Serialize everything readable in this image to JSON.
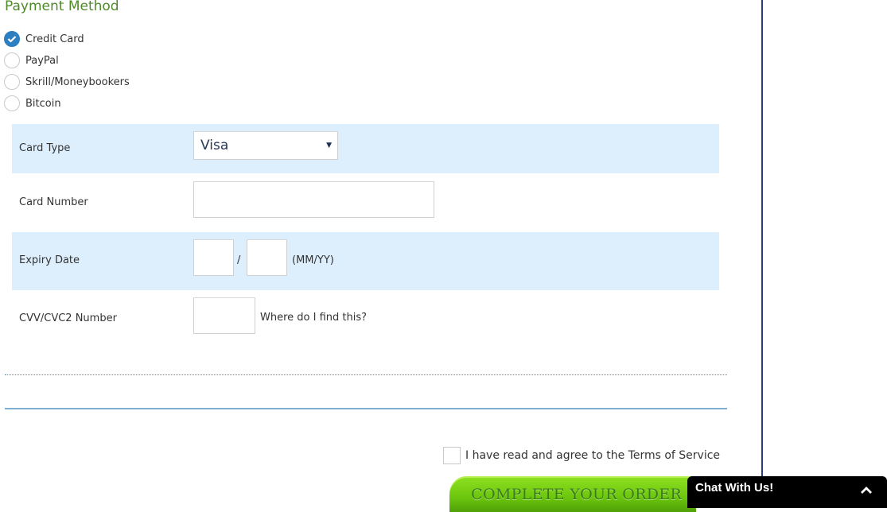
{
  "section_title": "Payment Method",
  "payment_methods": [
    {
      "label": "Credit Card",
      "selected": true
    },
    {
      "label": "PayPal",
      "selected": false
    },
    {
      "label": "Skrill/Moneybookers",
      "selected": false
    },
    {
      "label": "Bitcoin",
      "selected": false
    }
  ],
  "fields": {
    "card_type": {
      "label": "Card Type",
      "value": "Visa"
    },
    "card_number": {
      "label": "Card Number",
      "value": ""
    },
    "expiry": {
      "label": "Expiry Date",
      "month": "",
      "year": "",
      "separator": "/",
      "hint": "(MM/YY)"
    },
    "cvv": {
      "label": "CVV/CVC2 Number",
      "value": "",
      "help_link": "Where do I find this?"
    }
  },
  "terms": {
    "label": "I have read and agree to the Terms of Service",
    "checked": false
  },
  "order_button": {
    "label": "COMPLETE YOUR ORDER"
  },
  "chat": {
    "label": "Chat With Us!",
    "icon": "chevron-up-icon"
  },
  "colors": {
    "accent": "#2e7fc0",
    "title": "#4f8a2a",
    "band": "#ddeefd",
    "button": "#7ed321"
  }
}
